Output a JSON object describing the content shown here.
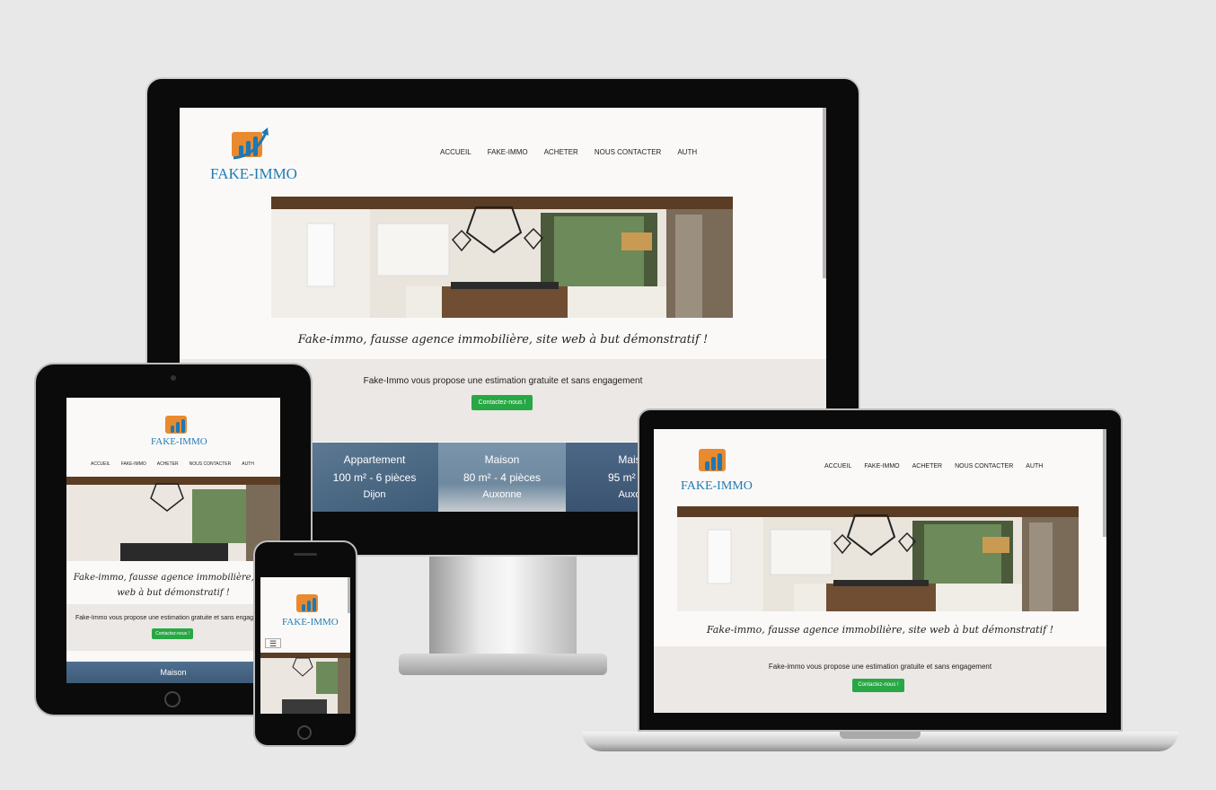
{
  "site": {
    "logo_text": "FAKE-IMMO",
    "nav": [
      "ACCUEIL",
      "FAKE-IMMO",
      "ACHETER",
      "NOUS CONTACTER",
      "AUTH"
    ],
    "tagline": "Fake-immo, fausse agence immobilière, site web à but démonstratif !",
    "tagline_tablet_l1": "Fake-immo, fausse agence immobilière, site",
    "tagline_tablet_l2": "web à but démonstratif !",
    "estimation_text": "Fake-Immo vous propose une estimation gratuite et sans engagement",
    "estimation_text_laptop": "Fake-immo vous propose une estimation gratuite et sans engagement",
    "contact_button": "Contactez-nous !",
    "menu_toggle": "☰"
  },
  "listings": [
    {
      "type": "Appartement",
      "size": "100 m² - 6 pièces",
      "city": "Dijon"
    },
    {
      "type": "Maison",
      "size": "80 m² - 4 pièces",
      "city": "Auxonne"
    },
    {
      "type": "Mais",
      "size": "95 m² - 5",
      "city": "Auxo"
    }
  ],
  "tablet_card": {
    "type": "Maison"
  },
  "colors": {
    "logo_blue": "#1e78b3",
    "logo_orange": "#e98a2f",
    "button_green": "#28a745",
    "band": "#ece8e5"
  }
}
